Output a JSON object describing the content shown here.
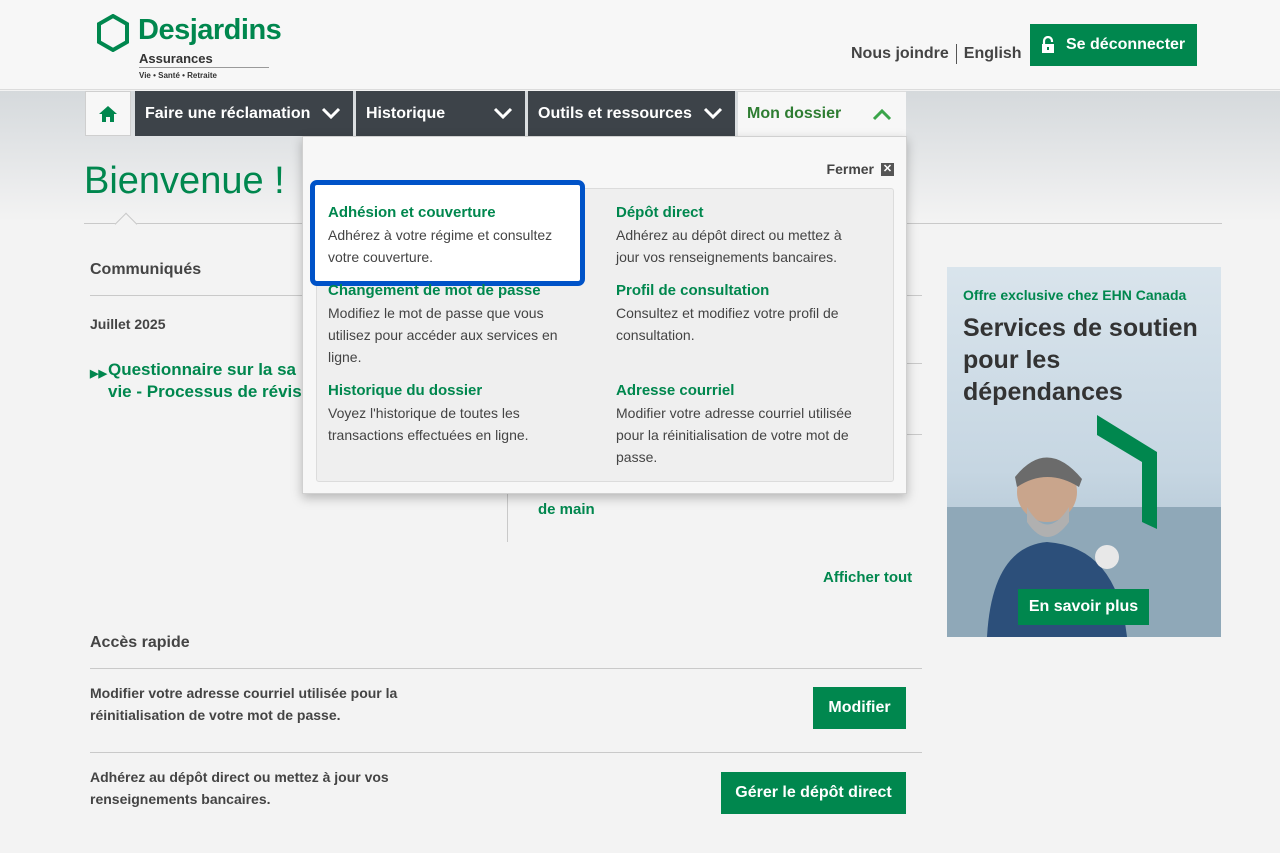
{
  "header": {
    "logo_name": "Desjardins",
    "logo_sub": "Assurances",
    "logo_tagline": "Vie • Santé • Retraite",
    "contact": "Nous joindre",
    "language": "English",
    "logout": "Se déconnecter"
  },
  "nav": {
    "items": [
      {
        "label": "Faire une réclamation"
      },
      {
        "label": "Historique"
      },
      {
        "label": "Outils et ressources"
      },
      {
        "label": "Mon dossier"
      }
    ]
  },
  "main": {
    "welcome": "Bienvenue !",
    "news_title": "Communiqués",
    "news_date": "Juillet 2025",
    "news_link": "Questionnaire sur la sa vie - Processus de révis",
    "partial_link": "de main",
    "view_all": "Afficher tout",
    "quick_title": "Accès rapide",
    "quick": [
      {
        "text": "Modifier votre adresse courriel utilisée pour la réinitialisation de votre mot de passe.",
        "button": "Modifier"
      },
      {
        "text": "Adhérez au dépôt direct ou mettez à jour vos renseignements bancaires.",
        "button": "Gérer le dépôt direct"
      }
    ]
  },
  "ad": {
    "offer": "Offre exclusive chez EHN Canada",
    "title": "Services de soutien pour les dépendances",
    "button": "En savoir plus"
  },
  "dropdown": {
    "close": "Fermer",
    "options": [
      {
        "title": "Adhésion et couverture",
        "desc": "Adhérez à votre régime et consultez votre couverture."
      },
      {
        "title": "Dépôt direct",
        "desc": "Adhérez au dépôt direct ou mettez à jour vos renseignements bancaires."
      },
      {
        "title": "Changement de mot de passe",
        "desc": "Modifiez le mot de passe que vous utilisez pour accéder aux services en ligne."
      },
      {
        "title": "Profil de consultation",
        "desc": "Consultez et modifiez votre profil de consultation."
      },
      {
        "title": "Historique du dossier",
        "desc": "Voyez l'historique de toutes les transactions effectuées en ligne."
      },
      {
        "title": "Adresse courriel",
        "desc": "Modifier votre adresse courriel utilisée pour la réinitialisation de votre mot de passe."
      }
    ]
  },
  "colors": {
    "brand_green": "#00874e",
    "nav_dark": "#3d4349",
    "highlight_blue": "#0053c8"
  }
}
